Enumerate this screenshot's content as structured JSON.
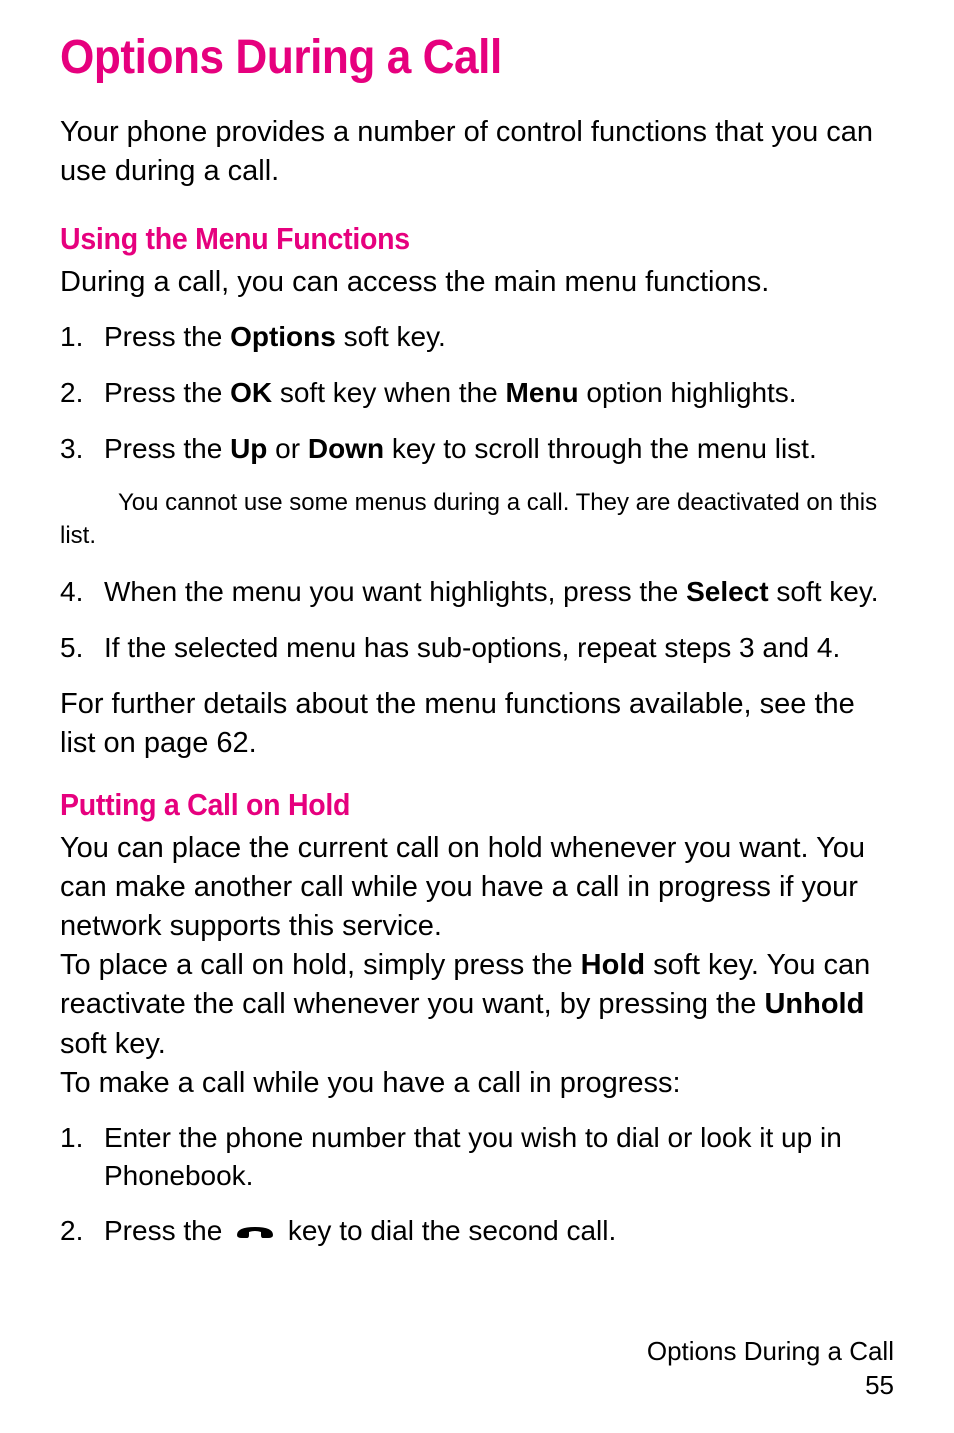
{
  "title": "Options During a Call",
  "intro": "Your phone provides a number of control functions that you can use during a call.",
  "section1": {
    "heading": "Using the Menu Functions",
    "intro": "During a call, you can access the main menu functions.",
    "steps_a": [
      {
        "num": "1.",
        "pre": "Press the ",
        "bold1": "Options",
        "post1": " soft key."
      },
      {
        "num": "2.",
        "pre": "Press the ",
        "bold1": "OK",
        "mid": " soft key when the ",
        "bold2": "Menu",
        "post2": " option highlights."
      },
      {
        "num": "3.",
        "pre": "Press the ",
        "bold1": "Up",
        "mid": " or ",
        "bold2": "Down",
        "post2": " key to scroll through the menu list."
      }
    ],
    "note": "You cannot use some menus during a call. They are deactivated on this list.",
    "steps_b": [
      {
        "num": "4.",
        "pre": "When the menu you want highlights, press the ",
        "bold1": "Select",
        "post1": " soft key."
      },
      {
        "num": "5.",
        "text": "If the selected menu has sub-options, repeat steps 3 and 4."
      }
    ],
    "outro": "For further details about the menu functions available, see the list on page 62."
  },
  "section2": {
    "heading": "Putting a Call on Hold",
    "p1_pre": "You can place the current call on hold whenever you want. You can make another call while you have a call in progress if your network supports this service.",
    "p2_pre": "To place a call on hold, simply press the ",
    "p2_bold1": "Hold",
    "p2_mid": " soft key. You can reactivate the call whenever you want, by pressing the ",
    "p2_bold2": "Unhold",
    "p2_post": " soft key.",
    "p3": "To make a call while you have a call in progress:",
    "steps": [
      {
        "num": "1.",
        "text": "Enter the phone number that you wish to dial or look it up in Phonebook."
      },
      {
        "num": "2.",
        "pre": "Press the ",
        "post": " key to dial the second call."
      }
    ]
  },
  "footer": {
    "label": "Options During a Call",
    "page": "55"
  }
}
